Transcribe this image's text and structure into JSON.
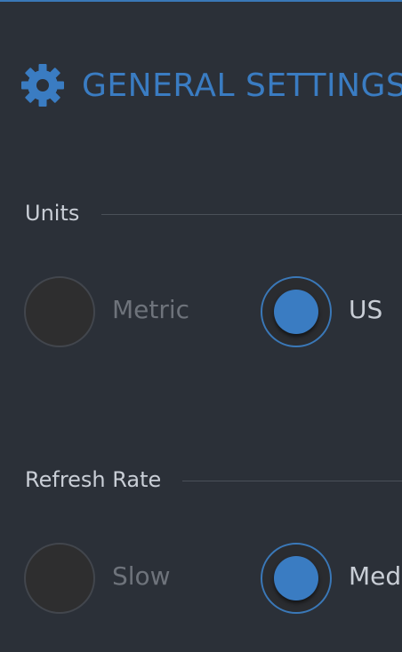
{
  "header": {
    "icon": "gear-icon",
    "title": "GENERAL SETTINGS"
  },
  "sections": [
    {
      "label": "Units",
      "options": [
        {
          "label": "Metric",
          "selected": false
        },
        {
          "label": "US",
          "selected": true
        }
      ]
    },
    {
      "label": "Refresh Rate",
      "options": [
        {
          "label": "Slow",
          "selected": false
        },
        {
          "label": "Med",
          "selected": true
        }
      ]
    }
  ],
  "colors": {
    "accent": "#3a7cc2",
    "background": "#2b3038"
  }
}
